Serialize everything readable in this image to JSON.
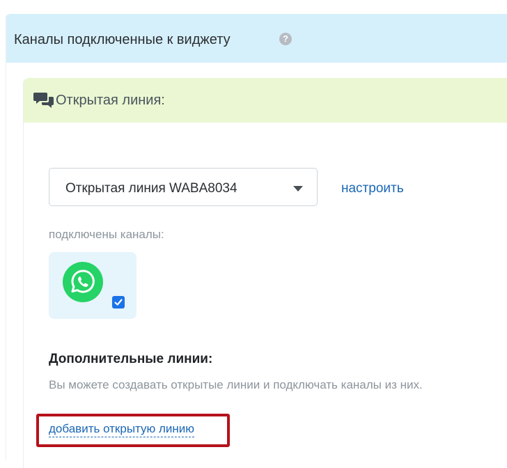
{
  "header": {
    "title": "Каналы подключенные к виджету",
    "help_icon": "question-circle-icon"
  },
  "section": {
    "title": "Открытая линия:",
    "icon": "chat-bubbles-icon",
    "select": {
      "value": "Открытая линия WABA8034"
    },
    "configure_link": "настроить",
    "connected_label": "подключены каналы:",
    "channels": [
      {
        "icon": "whatsapp-icon",
        "checked": true,
        "color": "#25d366"
      }
    ],
    "extra_lines": {
      "title": "Дополнительные линии:",
      "description": "Вы можете создавать открытые линии и подключать каналы из них.",
      "add_link": "добавить открытую линию"
    }
  },
  "colors": {
    "header_bg": "#d6f0fb",
    "section_header_bg": "#eaf7d2",
    "link": "#1a66b5",
    "highlight": "#b5121b",
    "checkbox": "#1a73e8"
  }
}
